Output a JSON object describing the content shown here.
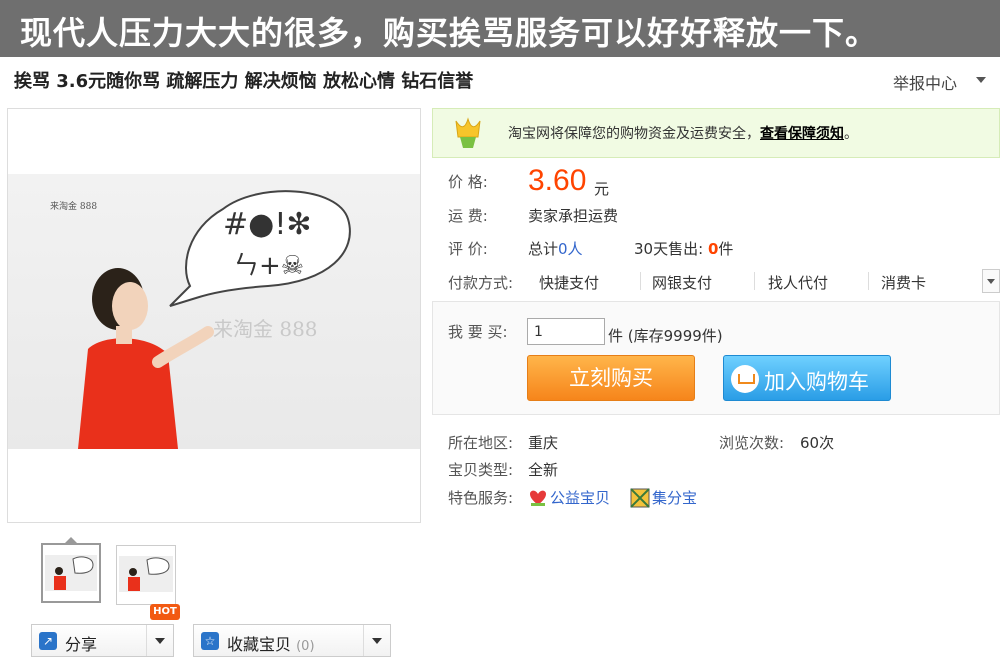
{
  "banner": {
    "text": "现代人压力大大的很多，购买挨骂服务可以好好释放一下。"
  },
  "header": {
    "item_title": "挨骂  3.6元随你骂  疏解压力  解决烦恼  放松心情  钻石信誉",
    "report_link": "举报中心"
  },
  "gallery": {
    "watermark_small": "来淘金 888",
    "watermark_large": "来淘金 888",
    "bubble_symbols_top": "#●!✻",
    "bubble_symbols_bottom": "ㄣ+☠"
  },
  "actions": {
    "share_label": "分享",
    "hot_badge": "HOT",
    "favorite_label": "收藏宝贝",
    "favorite_count": "(0)"
  },
  "safety": {
    "text": "淘宝网将保障您的购物资金及运费安全，",
    "link": "查看保障须知",
    "end": "。"
  },
  "details": {
    "price_label": "价      格:",
    "price": "3.60",
    "price_unit": "元",
    "shipping_label": "运      费:",
    "shipping_value": "卖家承担运费",
    "review_label": "评      价:",
    "review_prefix": "总计",
    "review_count": "0人",
    "sold_prefix": "30天售出:",
    "sold_count": "0",
    "sold_unit": "件",
    "payment_label": "付款方式:",
    "payment_methods": [
      "快捷支付",
      "网银支付",
      "找人代付",
      "消费卡"
    ]
  },
  "purchase": {
    "qty_label": "我 要 买:",
    "qty_value": "1",
    "stock_text": "件  (库存9999件)",
    "buy_now": "立刻购买",
    "add_cart": "加入购物车"
  },
  "meta": {
    "location_label": "所在地区:",
    "location_value": "重庆",
    "views_label": "浏览次数:",
    "views_value": "60次",
    "type_label": "宝贝类型:",
    "type_value": "全新",
    "services_label": "特色服务:",
    "service_1": "公益宝贝",
    "service_2": "集分宝"
  },
  "colors": {
    "price": "#ff4400",
    "buy_now": "#f6851b",
    "add_cart": "#2a9de6",
    "link": "#3366cc"
  }
}
